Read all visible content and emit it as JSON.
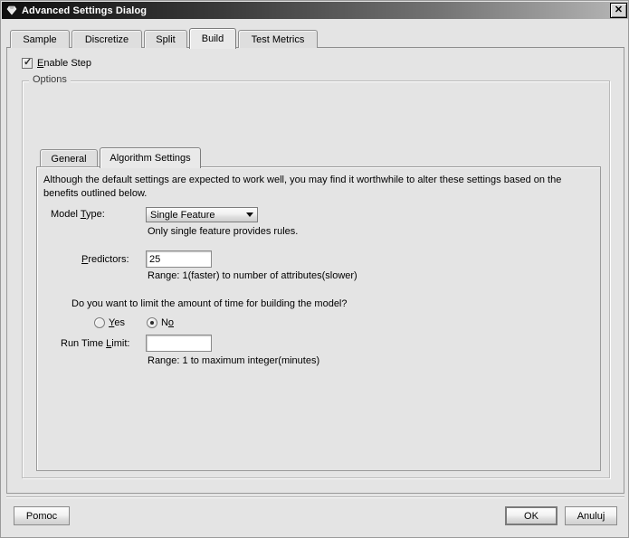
{
  "window": {
    "title": "Advanced Settings Dialog",
    "icon": "diamond-app-icon",
    "close_label": "✕"
  },
  "outer_tabs": [
    {
      "label": "Sample",
      "selected": false
    },
    {
      "label": "Discretize",
      "selected": false
    },
    {
      "label": "Split",
      "selected": false
    },
    {
      "label": "Build",
      "selected": true
    },
    {
      "label": "Test Metrics",
      "selected": false
    }
  ],
  "enable_step": {
    "label_before": "",
    "mnemonic": "E",
    "label_after": "nable Step",
    "checked": true,
    "check_glyph": "✓"
  },
  "options_group": {
    "legend": "Options"
  },
  "inner_tabs": [
    {
      "label": "General",
      "selected": false
    },
    {
      "label": "Algorithm Settings",
      "selected": true
    }
  ],
  "description": "Although the default settings are expected to work well, you may find it worthwhile to alter these settings based on the benefits outlined below.",
  "model_type": {
    "label_before": "Model ",
    "mnemonic": "T",
    "label_after": "ype:",
    "value": "Single Feature",
    "hint": "Only single feature provides rules."
  },
  "predictors": {
    "mnemonic": "P",
    "label_after": "redictors:",
    "value": "25",
    "hint": "Range: 1(faster) to number of attributes(slower)"
  },
  "time_limit_question": "Do you want to limit the amount of time for building the model?",
  "time_limit_radios": [
    {
      "mnemonic": "Y",
      "label_after": "es",
      "label_before": "",
      "selected": false
    },
    {
      "mnemonic": "o",
      "label_after": "",
      "label_before": "N",
      "selected": true
    }
  ],
  "run_time_limit": {
    "label_before": "Run Time ",
    "mnemonic": "L",
    "label_after": "imit:",
    "value": "",
    "hint": "Range: 1 to maximum integer(minutes)"
  },
  "buttons": {
    "help": "Pomoc",
    "help_mnemonic_index": 3,
    "ok": "OK",
    "cancel": "Anuluj"
  },
  "colors": {
    "background": "#e4e4e4",
    "titlebar_dark": "#0f0f0f",
    "border": "#9a9a9a",
    "field_background": "#ffffff"
  }
}
